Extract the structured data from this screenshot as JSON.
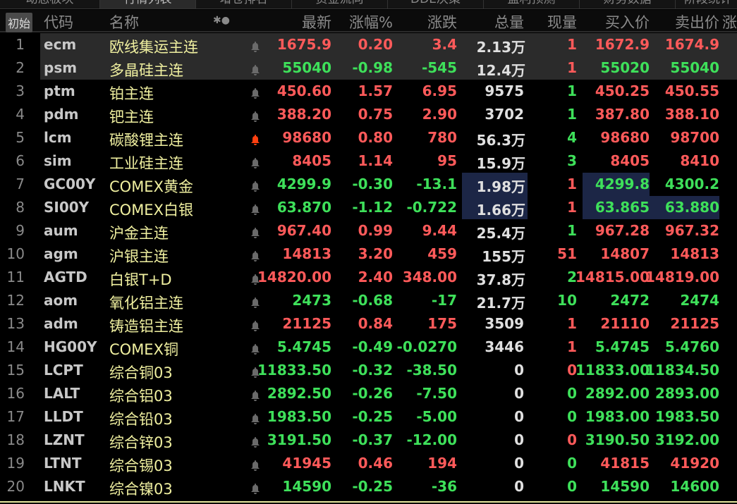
{
  "tabs": [
    "动态板块",
    "行情列表",
    "增仓排名",
    "资金流向",
    "DDE决策",
    "盈利预测",
    "财务数据",
    "阶段统计"
  ],
  "active_tab": 1,
  "header": {
    "init": "初始",
    "code": "代码",
    "name": "名称",
    "icons": "✱●",
    "latest": "最新",
    "pct": "涨幅%",
    "chg": "涨跌",
    "vol": "总量",
    "cur": "现量",
    "buy": "买入价",
    "sell": "卖出价",
    "more": "涨"
  },
  "colors": {
    "up": "#ff5a5a",
    "down": "#3ee05a",
    "name": "#f0f0a0",
    "alert_bell": "#ff4010",
    "bell": "#6a6a6a",
    "highlight": "#1c2646"
  },
  "rows": [
    {
      "n": "1",
      "code": "ecm",
      "name": "欧线集运主连",
      "latest": "1675.9",
      "pct": "0.20",
      "chg": "3.4",
      "vol": "2.13",
      "unit": "万",
      "cur": "1",
      "buy": "1672.9",
      "sell": "1674.9",
      "pc": "r",
      "cc": "r",
      "bc": "r",
      "sc": "r"
    },
    {
      "n": "2",
      "code": "psm",
      "name": "多晶硅主连",
      "latest": "55040",
      "pct": "-0.98",
      "chg": "-545",
      "vol": "12.4",
      "unit": "万",
      "cur": "1",
      "buy": "55020",
      "sell": "55040",
      "pc": "g",
      "cc": "r",
      "bc": "g",
      "sc": "g"
    },
    {
      "n": "3",
      "code": "ptm",
      "name": "铂主连",
      "latest": "450.60",
      "pct": "1.57",
      "chg": "6.95",
      "vol": "9575",
      "unit": "",
      "cur": "1",
      "buy": "450.25",
      "sell": "450.55",
      "pc": "r",
      "cc": "g",
      "bc": "r",
      "sc": "r"
    },
    {
      "n": "4",
      "code": "pdm",
      "name": "钯主连",
      "latest": "388.20",
      "pct": "0.75",
      "chg": "2.90",
      "vol": "3702",
      "unit": "",
      "cur": "1",
      "buy": "387.80",
      "sell": "388.10",
      "pc": "r",
      "cc": "g",
      "bc": "r",
      "sc": "r"
    },
    {
      "n": "5",
      "code": "lcm",
      "name": "碳酸锂主连",
      "latest": "98680",
      "pct": "0.80",
      "chg": "780",
      "vol": "56.3",
      "unit": "万",
      "cur": "4",
      "buy": "98680",
      "sell": "98700",
      "pc": "r",
      "cc": "g",
      "bc": "r",
      "sc": "r",
      "alert": true
    },
    {
      "n": "6",
      "code": "sim",
      "name": "工业硅主连",
      "latest": "8405",
      "pct": "1.14",
      "chg": "95",
      "vol": "15.9",
      "unit": "万",
      "cur": "3",
      "buy": "8405",
      "sell": "8410",
      "pc": "r",
      "cc": "g",
      "bc": "r",
      "sc": "r"
    },
    {
      "n": "7",
      "code": "GC00Y",
      "name": "COMEX黄金",
      "latest": "4299.9",
      "pct": "-0.30",
      "chg": "-13.1",
      "vol": "1.98",
      "unit": "万",
      "cur": "1",
      "buy": "4299.8",
      "sell": "4300.2",
      "pc": "g",
      "cc": "r",
      "bc": "g",
      "sc": "g",
      "hv": true,
      "hb": true
    },
    {
      "n": "8",
      "code": "SI00Y",
      "name": "COMEX白银",
      "latest": "63.870",
      "pct": "-1.12",
      "chg": "-0.722",
      "vol": "1.66",
      "unit": "万",
      "cur": "1",
      "buy": "63.865",
      "sell": "63.880",
      "pc": "g",
      "cc": "r",
      "bc": "g",
      "sc": "g",
      "hv": true,
      "hb": true,
      "hs": true
    },
    {
      "n": "9",
      "code": "aum",
      "name": "沪金主连",
      "latest": "967.40",
      "pct": "0.99",
      "chg": "9.44",
      "vol": "25.4",
      "unit": "万",
      "cur": "1",
      "buy": "967.28",
      "sell": "967.32",
      "pc": "r",
      "cc": "g",
      "bc": "r",
      "sc": "r"
    },
    {
      "n": "10",
      "code": "agm",
      "name": "沪银主连",
      "latest": "14813",
      "pct": "3.20",
      "chg": "459",
      "vol": "155",
      "unit": "万",
      "cur": "51",
      "buy": "14807",
      "sell": "14813",
      "pc": "r",
      "cc": "r",
      "bc": "r",
      "sc": "r"
    },
    {
      "n": "11",
      "code": "AGTD",
      "name": "白银T+D",
      "latest": "14820.00",
      "pct": "2.40",
      "chg": "348.00",
      "vol": "37.8",
      "unit": "万",
      "cur": "2",
      "buy": "14815.00",
      "sell": "14819.00",
      "pc": "r",
      "cc": "g",
      "bc": "r",
      "sc": "r"
    },
    {
      "n": "12",
      "code": "aom",
      "name": "氧化铝主连",
      "latest": "2473",
      "pct": "-0.68",
      "chg": "-17",
      "vol": "21.7",
      "unit": "万",
      "cur": "10",
      "buy": "2472",
      "sell": "2474",
      "pc": "g",
      "cc": "g",
      "bc": "g",
      "sc": "g"
    },
    {
      "n": "13",
      "code": "adm",
      "name": "铸造铝主连",
      "latest": "21125",
      "pct": "0.84",
      "chg": "175",
      "vol": "3509",
      "unit": "",
      "cur": "1",
      "buy": "21110",
      "sell": "21125",
      "pc": "r",
      "cc": "r",
      "bc": "r",
      "sc": "r"
    },
    {
      "n": "14",
      "code": "HG00Y",
      "name": "COMEX铜",
      "latest": "5.4745",
      "pct": "-0.49",
      "chg": "-0.0270",
      "vol": "3446",
      "unit": "",
      "cur": "1",
      "buy": "5.4745",
      "sell": "5.4760",
      "pc": "g",
      "cc": "r",
      "bc": "g",
      "sc": "g"
    },
    {
      "n": "15",
      "code": "LCPT",
      "name": "综合铜03",
      "latest": "11833.50",
      "pct": "-0.32",
      "chg": "-38.50",
      "vol": "0",
      "unit": "",
      "cur": "0",
      "buy": "11833.00",
      "sell": "11834.50",
      "pc": "g",
      "cc": "r",
      "bc": "g",
      "sc": "g"
    },
    {
      "n": "16",
      "code": "LALT",
      "name": "综合铝03",
      "latest": "2892.50",
      "pct": "-0.26",
      "chg": "-7.50",
      "vol": "0",
      "unit": "",
      "cur": "0",
      "buy": "2892.00",
      "sell": "2893.00",
      "pc": "g",
      "cc": "g",
      "bc": "g",
      "sc": "g"
    },
    {
      "n": "17",
      "code": "LLDT",
      "name": "综合铅03",
      "latest": "1983.50",
      "pct": "-0.25",
      "chg": "-5.00",
      "vol": "0",
      "unit": "",
      "cur": "0",
      "buy": "1983.00",
      "sell": "1983.50",
      "pc": "g",
      "cc": "g",
      "bc": "g",
      "sc": "g"
    },
    {
      "n": "18",
      "code": "LZNT",
      "name": "综合锌03",
      "latest": "3191.50",
      "pct": "-0.37",
      "chg": "-12.00",
      "vol": "0",
      "unit": "",
      "cur": "0",
      "buy": "3190.50",
      "sell": "3192.00",
      "pc": "g",
      "cc": "r",
      "bc": "g",
      "sc": "g"
    },
    {
      "n": "19",
      "code": "LTNT",
      "name": "综合锡03",
      "latest": "41945",
      "pct": "0.46",
      "chg": "194",
      "vol": "0",
      "unit": "",
      "cur": "0",
      "buy": "41815",
      "sell": "41920",
      "pc": "r",
      "cc": "g",
      "bc": "r",
      "sc": "r"
    },
    {
      "n": "20",
      "code": "LNKT",
      "name": "综合镍03",
      "latest": "14590",
      "pct": "-0.25",
      "chg": "-36",
      "vol": "0",
      "unit": "",
      "cur": "0",
      "buy": "14590",
      "sell": "14600",
      "pc": "g",
      "cc": "g",
      "bc": "g",
      "sc": "g"
    }
  ]
}
